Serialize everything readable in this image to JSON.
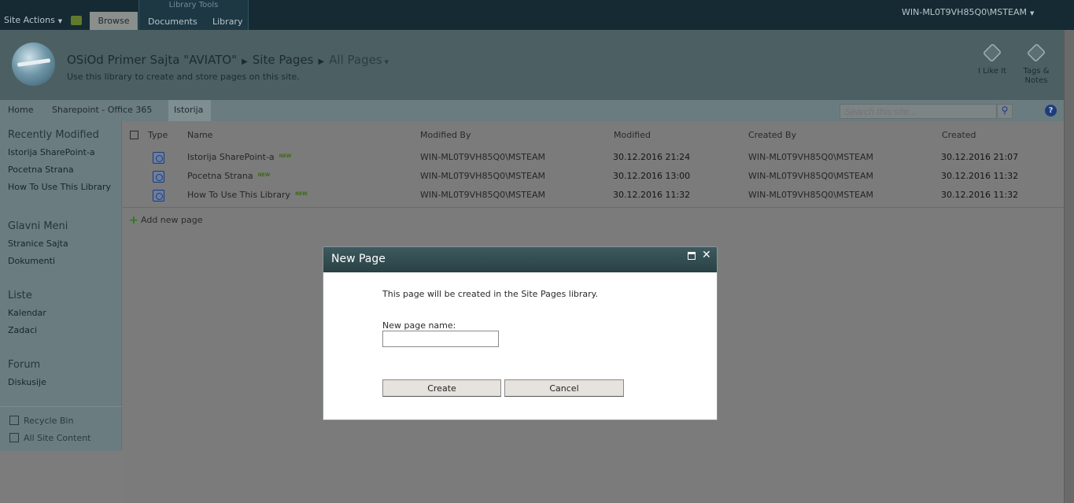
{
  "ribbon": {
    "site_actions": "Site Actions",
    "tab_browse": "Browse",
    "library_tools_label": "Library Tools",
    "tab_documents": "Documents",
    "tab_library": "Library",
    "user": "WIN-ML0T9VH85Q0\\MSTEAM"
  },
  "header": {
    "site_title": "OSiOd Primer Sajta \"AVIATO\"",
    "crumb_site_pages": "Site Pages",
    "crumb_all_pages": "All Pages",
    "description": "Use this library to create and store pages on this site.",
    "like_it": "I Like It",
    "tags_notes": "Tags &\nNotes"
  },
  "topnav": {
    "home": "Home",
    "office": "Sharepoint - Office 365",
    "istorija": "Istorija",
    "search_placeholder": "Search this site..."
  },
  "leftnav": {
    "recent_head": "Recently Modified",
    "recent_items": [
      "Istorija SharePoint-a",
      "Pocetna Strana",
      "How To Use This Library"
    ],
    "glavni_head": "Glavni Meni",
    "glavni_items": [
      "Stranice Sajta",
      "Dokumenti"
    ],
    "liste_head": "Liste",
    "liste_items": [
      "Kalendar",
      "Zadaci"
    ],
    "forum_head": "Forum",
    "forum_items": [
      "Diskusije"
    ],
    "recycle_bin": "Recycle Bin",
    "all_site_content": "All Site Content"
  },
  "table": {
    "headers": [
      "Type",
      "Name",
      "Modified By",
      "Modified",
      "Created By",
      "Created"
    ],
    "new_badge": "NEW",
    "rows": [
      {
        "name": "Istorija SharePoint-a",
        "modified_by": "WIN-ML0T9VH85Q0\\MSTEAM",
        "modified": "30.12.2016 21:24",
        "created_by": "WIN-ML0T9VH85Q0\\MSTEAM",
        "created": "30.12.2016 21:07"
      },
      {
        "name": "Pocetna Strana",
        "modified_by": "WIN-ML0T9VH85Q0\\MSTEAM",
        "modified": "30.12.2016 13:00",
        "created_by": "WIN-ML0T9VH85Q0\\MSTEAM",
        "created": "30.12.2016 11:32"
      },
      {
        "name": "How To Use This Library",
        "modified_by": "WIN-ML0T9VH85Q0\\MSTEAM",
        "modified": "30.12.2016 11:32",
        "created_by": "WIN-ML0T9VH85Q0\\MSTEAM",
        "created": "30.12.2016 11:32"
      }
    ],
    "add_new": "Add new page"
  },
  "dialog": {
    "title": "New Page",
    "message": "This page will be created in the Site Pages library.",
    "field_label": "New page name:",
    "field_value": "",
    "create": "Create",
    "cancel": "Cancel"
  }
}
